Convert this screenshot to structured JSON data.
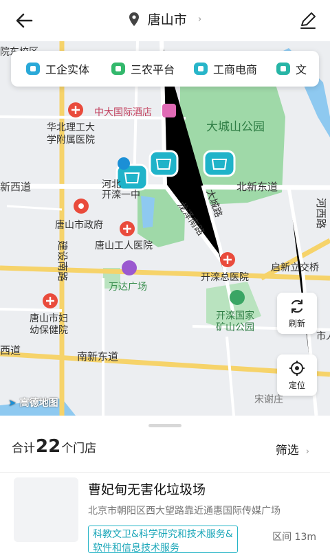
{
  "header": {
    "title": "唐山市"
  },
  "categories": [
    {
      "label": "工企实体",
      "color": "#2aa9d8"
    },
    {
      "label": "三农平台",
      "color": "#33b86c"
    },
    {
      "label": "工商电商",
      "color": "#28b5c9"
    },
    {
      "label": "文",
      "color": "#27b5a6"
    }
  ],
  "map": {
    "labels": {
      "hotel": "中大国际酒店",
      "park": "大城山公园",
      "hospital1a": "华北理工大",
      "hospital1b": "学附属医院",
      "road_xinxi": "新西道",
      "road_beixindong": "北新东道",
      "hebei": "河北",
      "kailuan": "开滦一中",
      "longze": "龙泽南路",
      "dacheng": "大城路",
      "hexi": "河西路",
      "govt": "唐山市政府",
      "workers_hospital": "唐山工人医院",
      "jianshe": "建设南路",
      "qixin": "启新立交桥",
      "kailuan_hospital": "开滦总医院",
      "wanda": "万达广场",
      "mine_park_a": "开滦国家",
      "mine_park_b": "矿山公园",
      "maternal_a": "唐山市妇",
      "maternal_b": "幼保健院",
      "road_xi": "西道",
      "road_nanxin": "南新东道",
      "songxie": "宋谢庄",
      "city_edge": "市人",
      "top_left": "院东校区"
    },
    "refresh_label": "刷新",
    "locate_label": "定位",
    "logo_text": "高德地图"
  },
  "summary": {
    "prefix": "合计",
    "count": "22",
    "suffix": "个门店"
  },
  "filter_label": "筛选",
  "store": {
    "name": "曹妃甸无害化垃圾场",
    "address": "北京市朝阳区西大望路靠近通惠国际传媒广场",
    "tag": "科教文卫&科学研究和技术服务&软件和信息技术服务",
    "distance": "区间 13m"
  }
}
